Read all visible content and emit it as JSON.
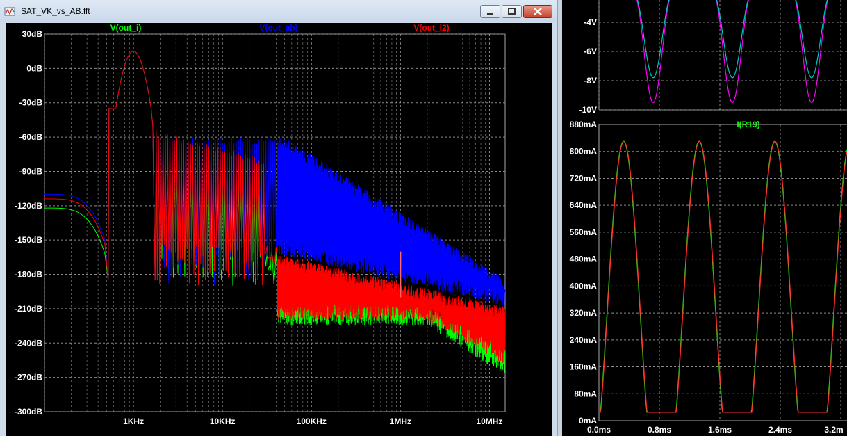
{
  "window": {
    "title": "SAT_VK_vs_AB.fft",
    "icon": "waveform-app-icon",
    "controls": [
      "minimize-icon",
      "maximize-icon",
      "close-icon"
    ]
  },
  "fft_plot": {
    "traces": [
      {
        "label": "V(out_i)",
        "color": "#00ff00"
      },
      {
        "label": "V(out_ab)",
        "color": "#0000ff"
      },
      {
        "label": "V(out_i2)",
        "color": "#ff0000"
      }
    ],
    "y_ticks": [
      "30dB",
      "0dB",
      "-30dB",
      "-60dB",
      "-90dB",
      "-120dB",
      "-150dB",
      "-180dB",
      "-210dB",
      "-240dB",
      "-270dB",
      "-300dB"
    ],
    "x_ticks": [
      "1KHz",
      "10KHz",
      "100KHz",
      "1MHz",
      "10MHz"
    ],
    "chart_data": {
      "type": "line",
      "x_scale": "log",
      "xlim": [
        "100Hz",
        "15MHz"
      ],
      "ylim": [
        -300,
        30
      ],
      "y_unit": "dB",
      "grid": true,
      "series": [
        {
          "name": "V(out_i)",
          "x_hz": [
            100,
            300,
            500,
            700,
            1000,
            1500,
            2000,
            3000,
            5000,
            10000,
            30000,
            40000,
            60000,
            100000,
            1000000,
            3000000,
            10000000,
            15000000
          ],
          "values": [
            -122,
            -132,
            -185,
            -30,
            15,
            -40,
            -185,
            -80,
            -95,
            -110,
            -140,
            -170,
            -190,
            -200,
            -200,
            -215,
            -245,
            -262
          ]
        },
        {
          "name": "V(out_ab)",
          "x_hz": [
            100,
            300,
            500,
            700,
            1000,
            1500,
            2000,
            3000,
            5000,
            10000,
            30000,
            40000,
            60000,
            100000,
            1000000,
            3000000,
            10000000,
            15000000
          ],
          "values": [
            -110,
            -125,
            -170,
            -30,
            15,
            -40,
            -150,
            -30,
            -55,
            -60,
            -75,
            -85,
            -100,
            -120,
            -150,
            -165,
            -180,
            -190
          ]
        },
        {
          "name": "V(out_i2)",
          "x_hz": [
            100,
            300,
            500,
            700,
            1000,
            1500,
            2000,
            3000,
            5000,
            10000,
            30000,
            40000,
            60000,
            100000,
            1000000,
            3000000,
            10000000,
            15000000
          ],
          "values": [
            -115,
            -128,
            -175,
            -30,
            15,
            -40,
            -175,
            -40,
            -75,
            -90,
            -135,
            -160,
            -195,
            -200,
            -195,
            -210,
            -225,
            -235
          ]
        }
      ]
    }
  },
  "voltage_plot": {
    "y_ticks": [
      "-4V",
      "-6V",
      "-8V",
      "-10V"
    ],
    "chart_data": {
      "type": "line",
      "ylim": [
        "-10V",
        "-2V"
      ],
      "series": [
        {
          "name": "magenta trace",
          "color": "#ff00ff",
          "minimum": "-9.5V"
        },
        {
          "name": "cyan trace",
          "color": "#00c8c8",
          "minimum": "-7.8V"
        }
      ]
    }
  },
  "current_plot": {
    "title": "I(R19)",
    "title_color": "#00ff00",
    "y_ticks": [
      "880mA",
      "800mA",
      "720mA",
      "640mA",
      "560mA",
      "480mA",
      "400mA",
      "320mA",
      "240mA",
      "160mA",
      "80mA",
      "0mA"
    ],
    "x_ticks": [
      "0.0ms",
      "0.8ms",
      "1.6ms",
      "2.4ms",
      "3.2m"
    ],
    "chart_data": {
      "type": "line",
      "x_unit": "ms",
      "y_unit": "mA",
      "xlim": [
        0,
        3.2
      ],
      "ylim": [
        0,
        880
      ],
      "series": [
        {
          "name": "I(R19)",
          "color": "#00ff00",
          "period_ms": 1.0,
          "peak_mA": 830,
          "floor_mA": 25
        },
        {
          "name": "red trace",
          "color": "#ff3030",
          "period_ms": 1.0,
          "peak_mA": 830,
          "floor_mA": 25
        }
      ]
    }
  }
}
